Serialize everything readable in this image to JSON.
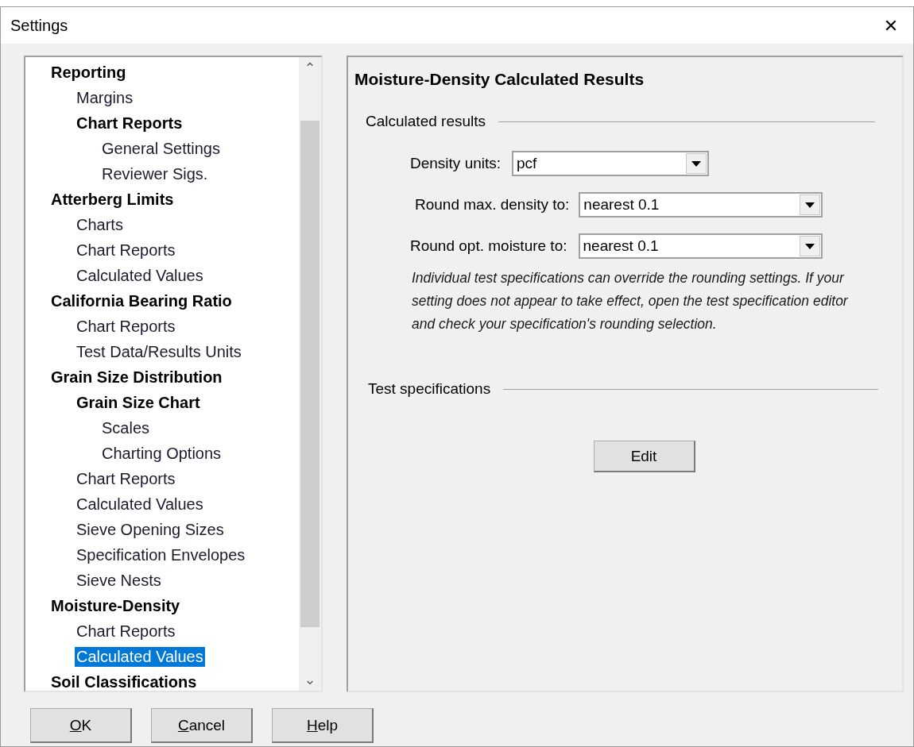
{
  "window": {
    "title": "Settings",
    "close": "✕"
  },
  "tree": {
    "scroll_up": "⌃",
    "scroll_down": "⌄",
    "items": [
      {
        "label": "Reporting",
        "kind": "group",
        "selected": false,
        "children": [
          {
            "label": "Margins",
            "kind": "page",
            "selected": false
          },
          {
            "label": "Chart Reports",
            "kind": "group",
            "selected": false,
            "children": [
              {
                "label": "General Settings",
                "kind": "page",
                "selected": false
              },
              {
                "label": "Reviewer Sigs.",
                "kind": "page",
                "selected": false
              }
            ]
          }
        ]
      },
      {
        "label": "Atterberg Limits",
        "kind": "group",
        "selected": false,
        "children": [
          {
            "label": "Charts",
            "kind": "page",
            "selected": false
          },
          {
            "label": "Chart Reports",
            "kind": "page",
            "selected": false
          },
          {
            "label": "Calculated Values",
            "kind": "page",
            "selected": false
          }
        ]
      },
      {
        "label": "California Bearing Ratio",
        "kind": "group",
        "selected": false,
        "children": [
          {
            "label": "Chart Reports",
            "kind": "page",
            "selected": false
          },
          {
            "label": "Test Data/Results Units",
            "kind": "page",
            "selected": false
          }
        ]
      },
      {
        "label": "Grain Size Distribution",
        "kind": "group",
        "selected": false,
        "children": [
          {
            "label": "Grain Size Chart",
            "kind": "group",
            "selected": false,
            "children": [
              {
                "label": "Scales",
                "kind": "page",
                "selected": false
              },
              {
                "label": "Charting Options",
                "kind": "page",
                "selected": false
              }
            ]
          },
          {
            "label": "Chart Reports",
            "kind": "page",
            "selected": false
          },
          {
            "label": "Calculated Values",
            "kind": "page",
            "selected": false
          },
          {
            "label": "Sieve Opening Sizes",
            "kind": "page",
            "selected": false
          },
          {
            "label": "Specification Envelopes",
            "kind": "page",
            "selected": false
          },
          {
            "label": "Sieve Nests",
            "kind": "page",
            "selected": false
          }
        ]
      },
      {
        "label": "Moisture-Density",
        "kind": "group",
        "selected": false,
        "children": [
          {
            "label": "Chart Reports",
            "kind": "page",
            "selected": false
          },
          {
            "label": "Calculated Values",
            "kind": "page",
            "selected": true
          }
        ]
      },
      {
        "label": "Soil Classifications",
        "kind": "group",
        "selected": false
      }
    ]
  },
  "panel": {
    "title": "Moisture-Density Calculated Results",
    "calculated_results": {
      "heading": "Calculated results",
      "fields": [
        {
          "label": "Density units:",
          "value": "pcf"
        },
        {
          "label": "Round max. density to:",
          "value": "nearest 0.1"
        },
        {
          "label": "Round opt. moisture to:",
          "value": "nearest 0.1"
        }
      ],
      "note": "Individual test specifications can override the rounding settings. If your setting does not appear to take effect, open the test specification editor and check your specification's rounding selection."
    },
    "test_specifications": {
      "heading": "Test specifications",
      "button": "Edit"
    }
  },
  "buttons": [
    {
      "label": "OK",
      "mnemonic_first": true
    },
    {
      "label": "Cancel",
      "mnemonic_first": true
    },
    {
      "label": "Help",
      "mnemonic_first": true
    }
  ]
}
